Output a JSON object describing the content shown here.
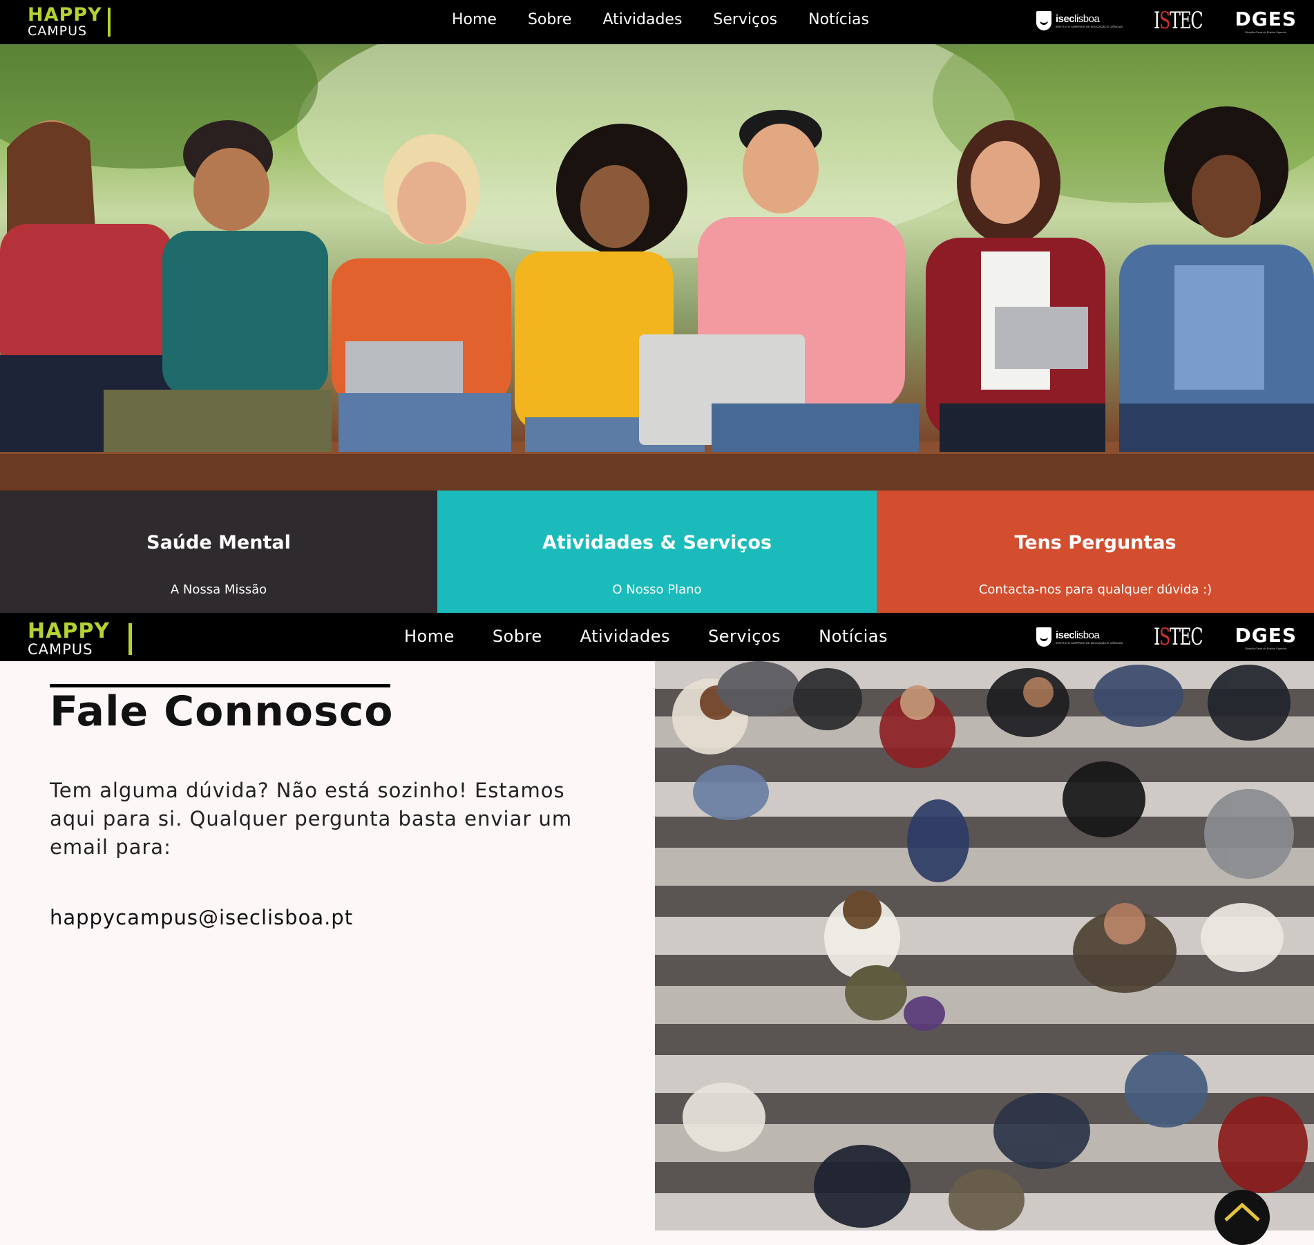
{
  "brand": {
    "logo_top": "HAPPY",
    "logo_bottom": "CAMPUS"
  },
  "nav": {
    "items": [
      "Home",
      "Sobre",
      "Atividades",
      "Serviços",
      "Notícias"
    ]
  },
  "partners": {
    "isec": {
      "bold": "isec",
      "light": "lisboa",
      "sub": "INSTITUTO SUPERIOR DE EDUCAÇÃO E CIÊNCIAS"
    },
    "istec": {
      "prefix": "I",
      "accent": "S",
      "suffix": "TEC"
    },
    "dges": {
      "name": "DGES",
      "sub": "Direção-Geral do Ensino Superior"
    }
  },
  "cards": [
    {
      "title": "Saúde Mental",
      "subtitle": "A Nossa Missão",
      "color": "#2e2a2d"
    },
    {
      "title": "Atividades & Serviços",
      "subtitle": "O Nosso Plano",
      "color": "#1bbbbb"
    },
    {
      "title": "Tens Perguntas",
      "subtitle": "Contacta-nos para qualquer dúvida :)",
      "color": "#d24e2e"
    }
  ],
  "contact": {
    "title": "Fale Connosco",
    "body": "Tem alguma dúvida? Não está sozinho! Estamos aqui para si. Qualquer pergunta basta enviar um email para:",
    "email": "happycampus@iseclisboa.pt"
  },
  "colors": {
    "accent_green": "#b3d333",
    "nav_bg": "#000000",
    "page_bg": "#fdf7f7"
  },
  "icons": {
    "scroll_top": "chevron-up-icon"
  }
}
